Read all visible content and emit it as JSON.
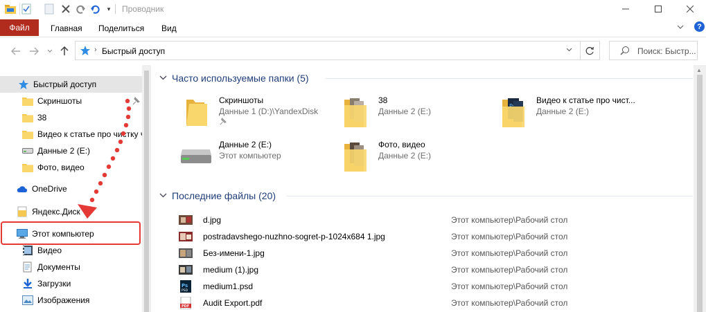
{
  "window": {
    "title": "Проводник",
    "minimize_icon": "minimize-icon",
    "maximize_icon": "maximize-icon",
    "close_icon": "close-icon"
  },
  "ribbon": {
    "tabs": [
      {
        "label": "Файл"
      },
      {
        "label": "Главная"
      },
      {
        "label": "Поделиться"
      },
      {
        "label": "Вид"
      }
    ],
    "help": "?",
    "file_tab_color": "#c42b1c"
  },
  "address": {
    "path": "Быстрый доступ",
    "search_placeholder": "Поиск: Быстр..."
  },
  "nav": {
    "items": [
      {
        "label": "Быстрый доступ",
        "icon": "star-icon"
      },
      {
        "label": "Скриншоты",
        "icon": "folder-icon"
      },
      {
        "label": "38",
        "icon": "folder-icon"
      },
      {
        "label": "Видео к статье про чистку ч",
        "icon": "folder-icon"
      },
      {
        "label": "Данные 2 (E:)",
        "icon": "drive-icon"
      },
      {
        "label": "Фото, видео",
        "icon": "folder-icon"
      },
      {
        "label": "OneDrive",
        "icon": "cloud-icon"
      },
      {
        "label": "Яндекс.Диск",
        "icon": "yandex-disk-icon"
      },
      {
        "label": "Этот компьютер",
        "icon": "computer-icon"
      },
      {
        "label": "Видео",
        "icon": "video-folder-icon"
      },
      {
        "label": "Документы",
        "icon": "documents-icon"
      },
      {
        "label": "Загрузки",
        "icon": "downloads-icon"
      },
      {
        "label": "Изображения",
        "icon": "pictures-icon"
      }
    ]
  },
  "frequent": {
    "header": "Часто используемые папки (5)",
    "tiles": [
      {
        "name": "Скриншоты",
        "sub": "Данные 1 (D:)\\YandexDisk",
        "pinned": true
      },
      {
        "name": "38",
        "sub": "Данные 2 (E:)"
      },
      {
        "name": "Видео к статье про чист...",
        "sub": "Данные 2 (E:)"
      },
      {
        "name": "Данные 2 (E:)",
        "sub": "Этот компьютер"
      },
      {
        "name": "Фото, видео",
        "sub": "Данные 2 (E:)"
      }
    ]
  },
  "recent": {
    "header": "Последние файлы (20)",
    "files": [
      {
        "name": "d.jpg",
        "location": "Этот компьютер\\Рабочий стол",
        "icon": "image-file-icon"
      },
      {
        "name": "postradavshego-nuzhno-sogret-p-1024x684 1.jpg",
        "location": "Этот компьютер\\Рабочий стол",
        "icon": "image-file-icon"
      },
      {
        "name": "Без-имени-1.jpg",
        "location": "Этот компьютер\\Рабочий стол",
        "icon": "image-file-icon"
      },
      {
        "name": "medium (1).jpg",
        "location": "Этот компьютер\\Рабочий стол",
        "icon": "image-file-icon"
      },
      {
        "name": "medium1.psd",
        "location": "Этот компьютер\\Рабочий стол",
        "icon": "psd-file-icon"
      },
      {
        "name": "Audit Export.pdf",
        "location": "Этот компьютер\\Рабочий стол",
        "icon": "pdf-file-icon"
      }
    ]
  },
  "colors": {
    "accent": "#1e63d6",
    "highlight": "#e53935",
    "folder": "#f5c851"
  }
}
